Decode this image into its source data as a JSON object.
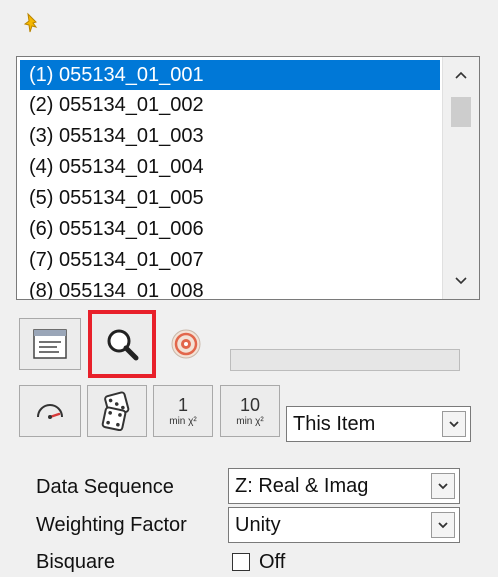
{
  "toolbar_top": {
    "pin_icon": "pin-icon"
  },
  "item_list": {
    "items": [
      "(1) 055134_01_001",
      "(2) 055134_01_002",
      "(3) 055134_01_003",
      "(4) 055134_01_004",
      "(5) 055134_01_005",
      "(6) 055134_01_006",
      "(7) 055134_01_007",
      "(8) 055134_01_008"
    ],
    "selected_index": 0,
    "scroll_up": "^",
    "scroll_down": "v"
  },
  "tools_row1": {
    "buttons": [
      "list-view-icon",
      "magnifier-icon",
      "target-icon"
    ],
    "highlighted": "magnifier-icon"
  },
  "tools_row2": {
    "min_chi1": {
      "num": "1",
      "sub": "min χ²"
    },
    "min_chi10": {
      "num": "10",
      "sub": "min χ²"
    },
    "scope_select": "This Item",
    "dropdown_arrow": "v"
  },
  "settings": {
    "data_sequence": {
      "label": "Data Sequence",
      "value": "Z: Real & Imag"
    },
    "weighting_factor": {
      "label": "Weighting Factor",
      "value": "Unity"
    },
    "bisquare": {
      "label": "Bisquare",
      "value": "Off",
      "checked": false
    }
  },
  "colors": {
    "selection": "#0078d7",
    "highlight_border": "#e8202a",
    "pin": "#f5b800"
  }
}
